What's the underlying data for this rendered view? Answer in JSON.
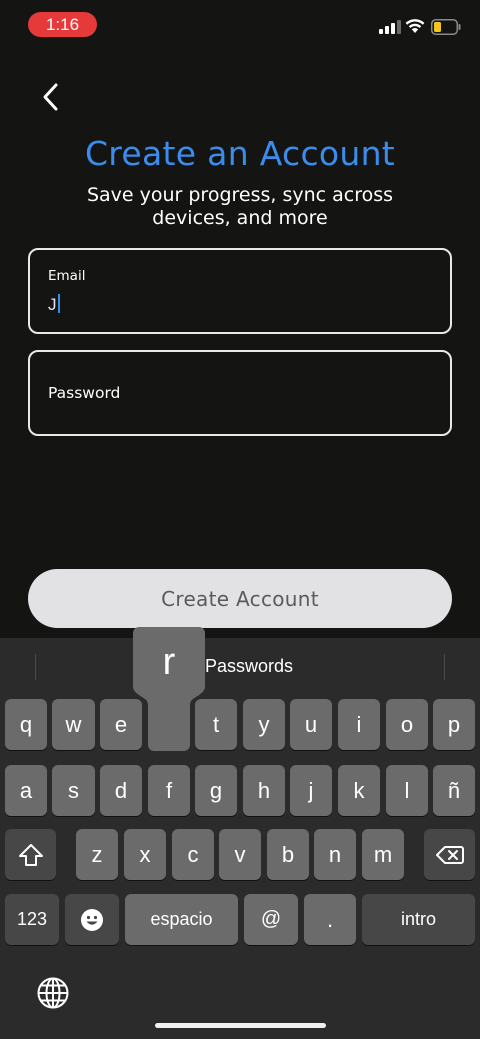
{
  "status_bar": {
    "time": "1:16"
  },
  "header": {
    "title": "Create an Account",
    "subtitle": "Save your progress, sync across devices, and more"
  },
  "form": {
    "email_label": "Email",
    "email_value": "J",
    "password_label": "Password",
    "submit_label": "Create Account"
  },
  "keyboard": {
    "suggestion": "Passwords",
    "popup_letter": "r",
    "row1": [
      "q",
      "w",
      "e",
      "r",
      "t",
      "y",
      "u",
      "i",
      "o",
      "p"
    ],
    "row2": [
      "a",
      "s",
      "d",
      "f",
      "g",
      "h",
      "j",
      "k",
      "l",
      "ñ"
    ],
    "row3": [
      "z",
      "x",
      "c",
      "v",
      "b",
      "n",
      "m"
    ],
    "numbers_label": "123",
    "space_label": "espacio",
    "at_label": "@",
    "dot_label": ".",
    "return_label": "intro"
  },
  "colors": {
    "accent": "#3b8ded",
    "time_pill": "#e5393a",
    "background": "#141413"
  },
  "icons": [
    "signal-icon",
    "wifi-icon",
    "battery-icon",
    "back-chevron-icon",
    "shift-icon",
    "backspace-icon",
    "emoji-icon",
    "globe-icon"
  ]
}
